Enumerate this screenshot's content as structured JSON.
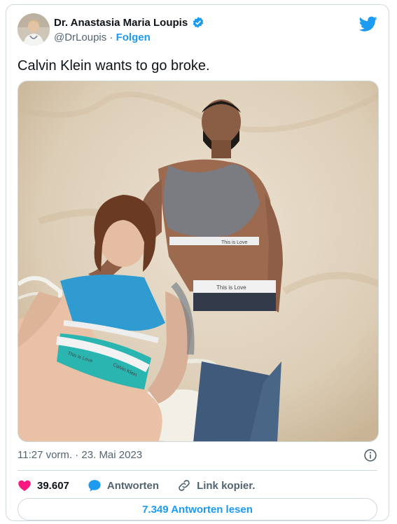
{
  "author": {
    "name": "Dr. Anastasia Maria Loupis",
    "handle": "@DrLoupis",
    "separator": "·",
    "follow_label": "Folgen"
  },
  "tweet": {
    "text": "Calvin Klein wants to go broke.",
    "timestamp": "11:27 vorm. · 23. Mai 2023"
  },
  "media": {
    "waistband_texts": [
      "This is Love",
      "Calvin Klein",
      "This is Love",
      "Calvin Klein"
    ]
  },
  "actions": {
    "likes": "39.607",
    "reply_label": "Antworten",
    "copy_link_label": "Link kopier.",
    "read_replies_label": "7.349 Antworten lesen"
  },
  "colors": {
    "accent": "#1d9bf0",
    "like": "#f91880",
    "muted": "#536471"
  },
  "icons": [
    "verified-badge-icon",
    "twitter-bird-icon",
    "info-icon",
    "heart-icon",
    "reply-icon",
    "link-icon"
  ]
}
